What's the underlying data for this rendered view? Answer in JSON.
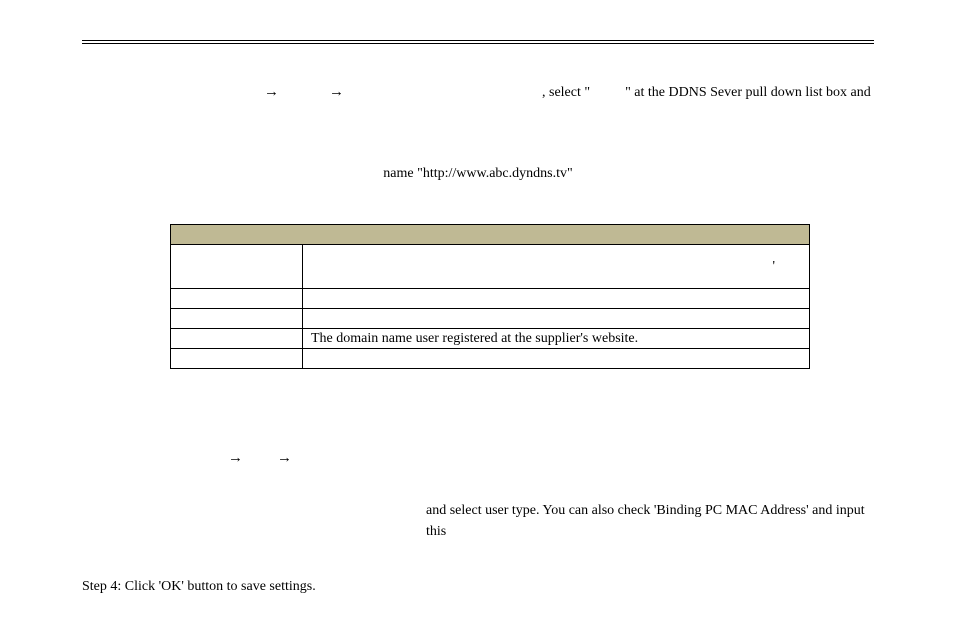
{
  "top": {
    "arrow1": "→",
    "arrow2": "→",
    "after_arrows": ", select \"",
    "after_quote": "\" at the DDNS Sever pull down list box and"
  },
  "center_line": "name \"http://www.abc.dyndns.tv\"",
  "table": {
    "header": "",
    "rows": {
      "r1_left": "",
      "r1_right_apos": "'",
      "r2_left": "",
      "r2_right": "",
      "r3_left": "",
      "r3_right": "",
      "r4_left": "",
      "r4_right": "The domain name user registered at the supplier's website.",
      "r5_left": "",
      "r5_right": ""
    }
  },
  "step2": {
    "arrow1": "→",
    "arrow2": "→"
  },
  "step3_line": "and select user type. You can also check 'Binding PC MAC Address' and input this",
  "step4": "Step 4: Click 'OK' button to save settings."
}
